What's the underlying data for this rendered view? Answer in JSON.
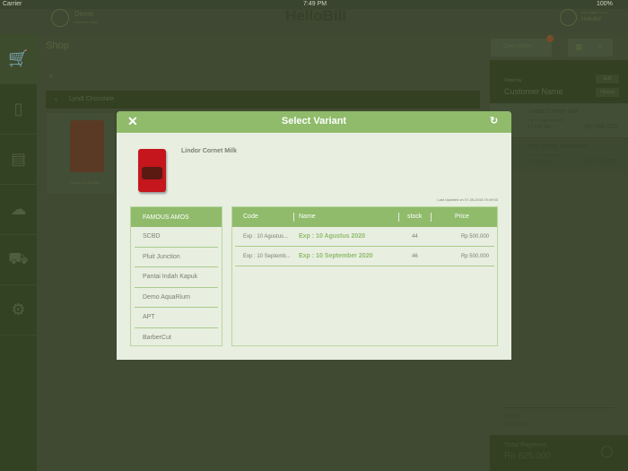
{
  "status_bar": {
    "carrier": "Carrier",
    "time": "7:49 PM",
    "battery": "100%"
  },
  "header": {
    "store_name": "Demo",
    "store_sub": "Interface mode",
    "app_title": "HelloBill",
    "user_sub": "you logged in as",
    "user_name": "HelloBill"
  },
  "shop": {
    "title": "Shop",
    "category": "Lyndt Chocolate",
    "product_card": "Lindor Cornet Milk",
    "open_order": "Open Order",
    "open_order_badge": "0"
  },
  "order": {
    "order_by_label": "Order by",
    "customer": "Customer Name",
    "btn1": "Edit",
    "btn2": "History",
    "items": [
      {
        "name": "Lindor Cornet Milk",
        "exp": "Exp : 10 Agustus 2020",
        "qty": "1 x 500.000",
        "total": "Rp 500.000"
      },
      {
        "name": "Red Velvet Sandwich",
        "exp": "Exp : 10 Januari 2021",
        "qty": "1 x 250.000",
        "total": "Rp 250.000"
      }
    ],
    "notes_label": "Notes:",
    "notes_placeholder": "Add Notes",
    "total_label": "Total Payment",
    "total_value": "Rp 825.000"
  },
  "modal": {
    "title": "Select Variant",
    "product_name": "Lindor Cornet Milk",
    "last_updated": "Last Updated on 07-05-2018 19:49:03",
    "outlets": [
      "FAMOUS AMOS",
      "SCBD",
      "Pluit Junction",
      "Pantai Indah Kapuk",
      "Demo AquaRium",
      "APT",
      "BarberCut"
    ],
    "columns": {
      "code": "Code",
      "name": "Name",
      "stock": "stock",
      "price": "Price"
    },
    "rows": [
      {
        "code": "Exp : 10 Agustus...",
        "name": "Exp : 10  Agustus 2020",
        "stock": "44",
        "price": "Rp 500.000"
      },
      {
        "code": "Exp : 10 Septemb...",
        "name": "Exp : 10  September 2020",
        "stock": "46",
        "price": "Rp 500.000"
      }
    ]
  },
  "colors": {
    "accent": "#8fbb6b",
    "modal_bg": "#e8eee0"
  }
}
